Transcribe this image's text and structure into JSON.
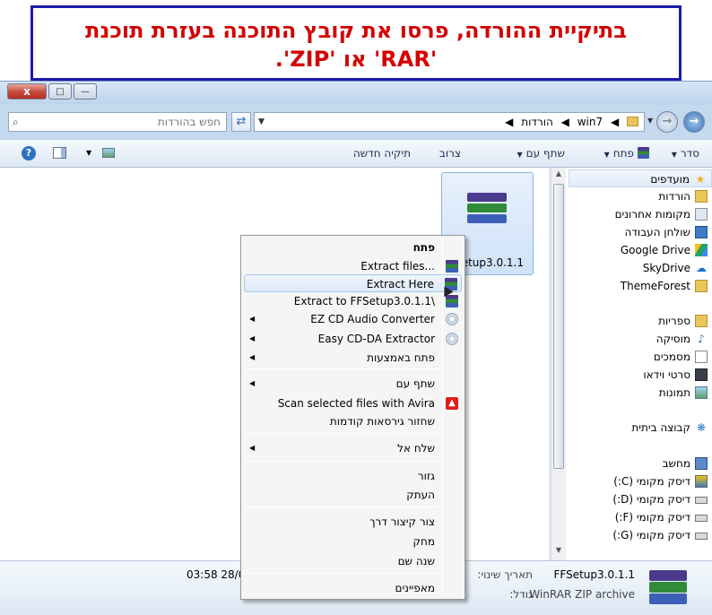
{
  "banner": {
    "line1": "בתיקיית ההורדה, פרסו את קובץ התוכנה בעזרת תוכנת",
    "line2": "'RAR' או 'ZIP'."
  },
  "window": {
    "buttons": {
      "close": "x",
      "maximize": "□",
      "minimize": "—"
    }
  },
  "address": {
    "search_placeholder": "חפש בהורדות",
    "path": [
      "win7",
      "הורדות"
    ]
  },
  "toolbar": {
    "organize": "סדר",
    "open": "פתח",
    "share_with": "שתף עם",
    "burn": "צרוב",
    "new_folder": "תיקיה חדשה"
  },
  "nav": {
    "favorites_header": "מועדפים",
    "favorites": [
      "הורדות",
      "מקומות אחרונים",
      "שולחן העבודה",
      "Google Drive",
      "SkyDrive",
      "ThemeForest"
    ],
    "libraries_header": "ספריות",
    "libraries": [
      "מוסיקה",
      "מסמכים",
      "סרטי וידאו",
      "תמונות"
    ],
    "homegroup": "קבוצה ביתית",
    "computer_header": "מחשב",
    "drives": [
      "דיסק מקומי (C:)",
      "דיסק מקומי (D:)",
      "דיסק מקומי (F:)",
      "דיסק מקומי (G:)"
    ]
  },
  "file": {
    "name_partial": "etup3.0.1.1",
    "name": "FFSetup3.0.1.1",
    "type": "WinRAR ZIP archive",
    "modified_label": "תאריך שינוי:",
    "modified_value": "03:58 28/0",
    "size_label": "גודל:"
  },
  "context_menu": {
    "items": [
      {
        "label": "פתח",
        "icon": "none"
      },
      {
        "label": "Extract files...",
        "icon": "winrar-icon"
      },
      {
        "label": "Extract Here",
        "icon": "winrar-icon"
      },
      {
        "label": "Extract to FFSetup3.0.1.1\\",
        "icon": "winrar-icon"
      },
      {
        "label": "EZ CD Audio Converter",
        "icon": "cd-icon"
      },
      {
        "label": "Easy CD-DA Extractor",
        "icon": "cd-icon"
      },
      {
        "label": "פתח באמצעות",
        "icon": "none"
      },
      {
        "label": "שתף עם",
        "icon": "none"
      },
      {
        "label": "Scan selected files with Avira",
        "icon": "avira-icon"
      },
      {
        "label": "שחזור גירסאות קודמות",
        "icon": "none"
      },
      {
        "label": "שלח אל",
        "icon": "none"
      },
      {
        "label": "גזור",
        "icon": "none"
      },
      {
        "label": "העתק",
        "icon": "none"
      },
      {
        "label": "צור קיצור דרך",
        "icon": "none"
      },
      {
        "label": "מחק",
        "icon": "none"
      },
      {
        "label": "שנה שם",
        "icon": "none"
      },
      {
        "label": "מאפיינים",
        "icon": "none"
      }
    ]
  },
  "colors": {
    "banner_text": "#d30000",
    "banner_border": "#1b1ba8",
    "window_frame": "#c4d8ee",
    "menu_highlight": "#dce9f8"
  }
}
